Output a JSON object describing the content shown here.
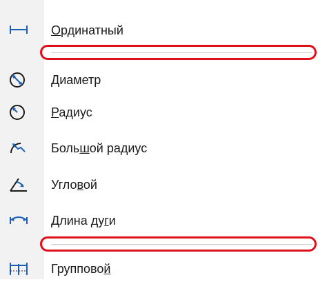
{
  "menu": {
    "items": [
      {
        "pre": "",
        "ul": "О",
        "post": "рдинатный",
        "icon": "ordinate-dimension-icon"
      },
      {
        "pre": "",
        "ul": "Д",
        "post": "иаметр",
        "icon": "diameter-dimension-icon"
      },
      {
        "pre": "",
        "ul": "Р",
        "post": "адиус",
        "icon": "radius-dimension-icon"
      },
      {
        "pre": "Боль",
        "ul": "ш",
        "post": "ой радиус",
        "icon": "large-radius-dimension-icon"
      },
      {
        "pre": "Угло",
        "ul": "в",
        "post": "ой",
        "icon": "angular-dimension-icon"
      },
      {
        "pre": "Длина ду",
        "ul": "г",
        "post": "и",
        "icon": "arc-length-dimension-icon"
      },
      {
        "pre": "Группово",
        "ul": "й",
        "post": "",
        "icon": "group-dimension-icon"
      }
    ]
  },
  "highlight_color": "#e0101a"
}
